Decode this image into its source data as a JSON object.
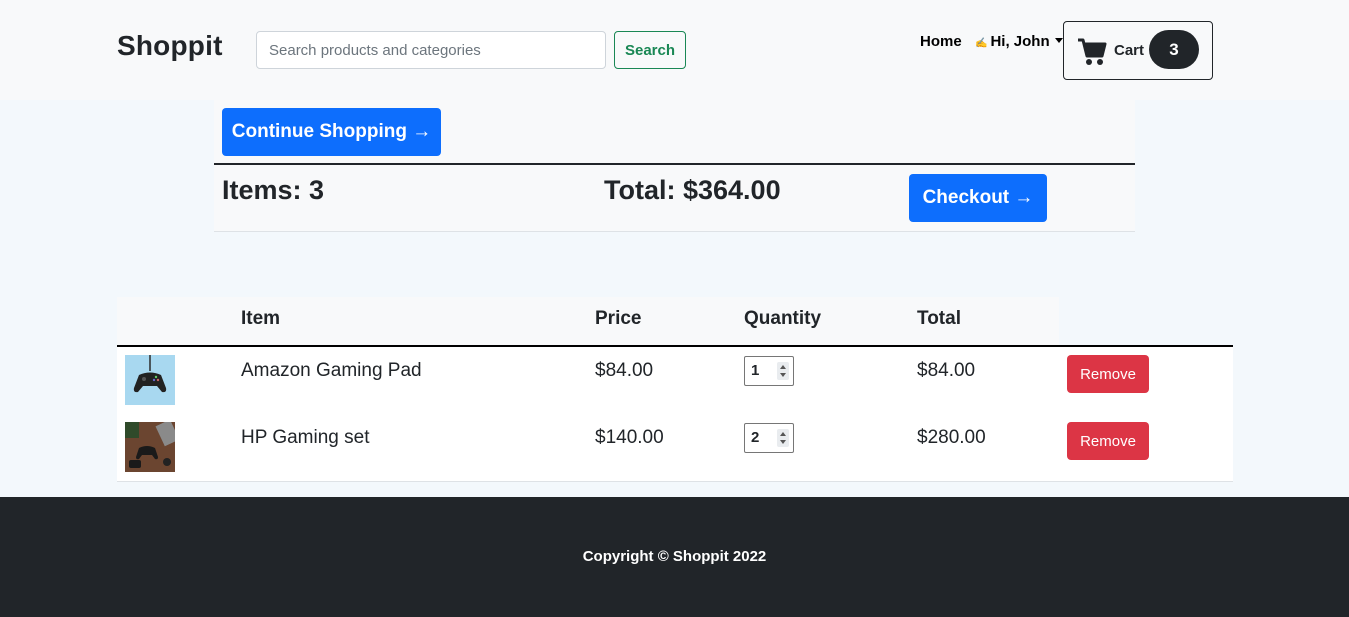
{
  "navbar": {
    "brand": "Shoppit",
    "search_placeholder": "Search products and categories",
    "search_label": "Search",
    "home_label": "Home",
    "user_label": "Hi, John",
    "cart_label": "Cart",
    "cart_count": "3"
  },
  "summary": {
    "continue_label": "Continue Shopping →",
    "items_label": "Items: 3",
    "total_label": "Total: $364.00",
    "checkout_label": "Checkout →"
  },
  "table": {
    "headers": [
      "",
      "Item",
      "Price",
      "Quantity",
      "Total"
    ],
    "rows": [
      {
        "image": "gaming-pad-thumbnail",
        "name": "Amazon Gaming Pad",
        "price": "$84.00",
        "quantity": "1",
        "total": "$84.00",
        "remove_label": "Remove"
      },
      {
        "image": "gaming-set-thumbnail",
        "name": "HP Gaming set",
        "price": "$140.00",
        "quantity": "2",
        "total": "$280.00",
        "remove_label": "Remove"
      }
    ]
  },
  "footer": {
    "copyright": "Copyright © Shoppit 2022"
  },
  "colors": {
    "primary": "#0d6efd",
    "success": "#198754",
    "danger": "#dc3545",
    "dark": "#212529",
    "page_bg": "#f3f8fc"
  }
}
